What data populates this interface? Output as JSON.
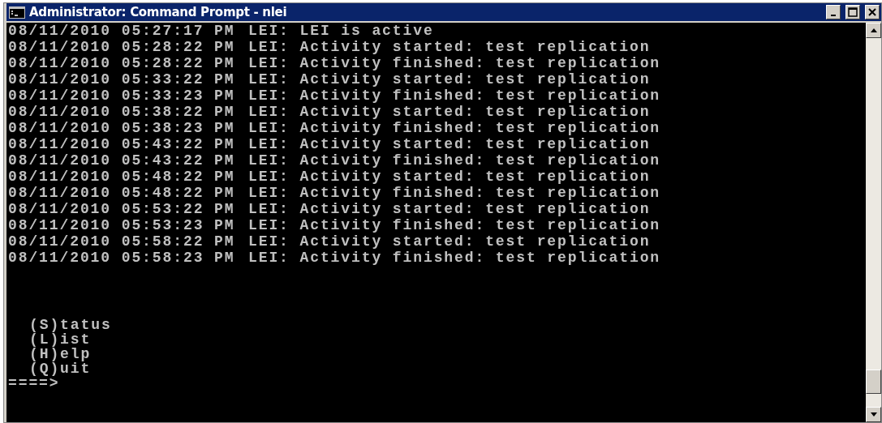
{
  "window": {
    "title": "Administrator: Command Prompt - nlei"
  },
  "log": [
    {
      "time": "08/11/2010 05:27:17 PM",
      "message": "LEI: LEI is active"
    },
    {
      "time": "08/11/2010 05:28:22 PM",
      "message": "LEI: Activity started: test replication"
    },
    {
      "time": "08/11/2010 05:28:22 PM",
      "message": "LEI: Activity finished: test replication"
    },
    {
      "time": "08/11/2010 05:33:22 PM",
      "message": "LEI: Activity started: test replication"
    },
    {
      "time": "08/11/2010 05:33:23 PM",
      "message": "LEI: Activity finished: test replication"
    },
    {
      "time": "08/11/2010 05:38:22 PM",
      "message": "LEI: Activity started: test replication"
    },
    {
      "time": "08/11/2010 05:38:23 PM",
      "message": "LEI: Activity finished: test replication"
    },
    {
      "time": "08/11/2010 05:43:22 PM",
      "message": "LEI: Activity started: test replication"
    },
    {
      "time": "08/11/2010 05:43:22 PM",
      "message": "LEI: Activity finished: test replication"
    },
    {
      "time": "08/11/2010 05:48:22 PM",
      "message": "LEI: Activity started: test replication"
    },
    {
      "time": "08/11/2010 05:48:22 PM",
      "message": "LEI: Activity finished: test replication"
    },
    {
      "time": "08/11/2010 05:53:22 PM",
      "message": "LEI: Activity started: test replication"
    },
    {
      "time": "08/11/2010 05:53:23 PM",
      "message": "LEI: Activity finished: test replication"
    },
    {
      "time": "08/11/2010 05:58:22 PM",
      "message": "LEI: Activity started: test replication"
    },
    {
      "time": "08/11/2010 05:58:23 PM",
      "message": "LEI: Activity finished: test replication"
    }
  ],
  "menu": [
    "(S)tatus",
    "(L)ist",
    "(H)elp",
    "(Q)uit"
  ],
  "prompt": "====>"
}
